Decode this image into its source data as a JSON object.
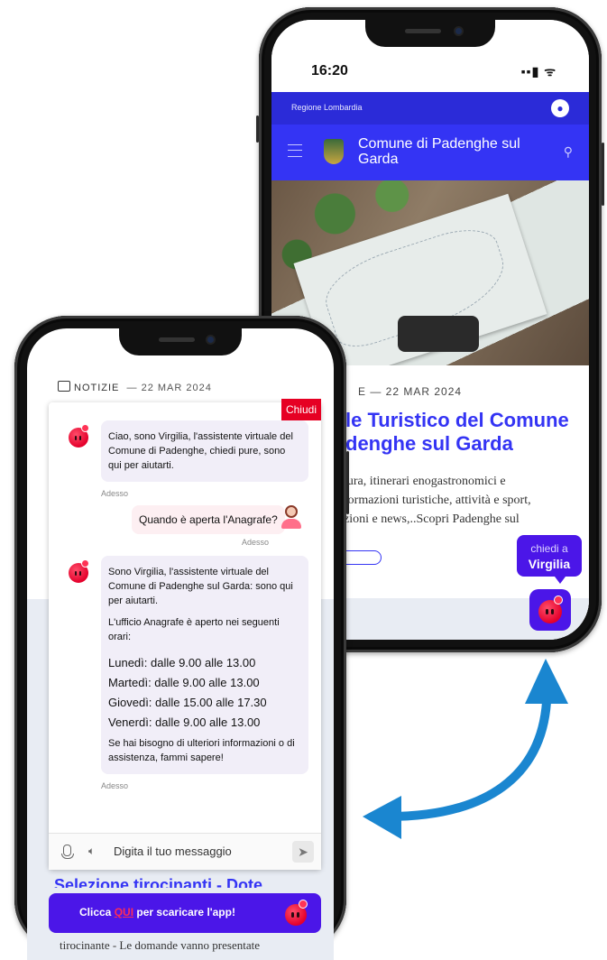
{
  "back_phone": {
    "status_time": "16:20",
    "status_icons": "▪▪▮ ᯤ",
    "region_label": "Regione Lombardia",
    "site_title": "Comune di Padenghe sul Garda",
    "news_date": "E  —  22 MAR 2024",
    "headline": "le Turistico del Comune\ndenghe sul Garda",
    "description": "tura, itinerari enogastronomici e\nformazioni turistiche, attività e sport,\nzioni e news,..Scopri Padenghe sul",
    "virgilia_small": "chiedi a",
    "virgilia_big": "Virgilia"
  },
  "front_phone": {
    "section_label": "NOTIZIE",
    "section_date": "— 22 MAR 2024",
    "close_label": "Chiudi",
    "messages": [
      {
        "from": "bot",
        "text": "Ciao, sono Virgilia, l'assistente virtuale del Comune di Padenghe, chiedi pure, sono qui per aiutarti.",
        "time": "Adesso"
      },
      {
        "from": "user",
        "text": "Quando è aperta l'Anagrafe?",
        "time": "Adesso"
      },
      {
        "from": "bot",
        "intro": "Sono Virgilia, l'assistente virtuale del Comune di Padenghe sul Garda: sono qui per aiutarti.",
        "line2": "L'ufficio Anagrafe è aperto nei seguenti orari:",
        "schedule": [
          "Lunedì: dalle 9.00 alle 13.00",
          "Martedì: dalle 9.00 alle 13.00",
          "Giovedì: dalle 15.00 alle 17.30",
          "Venerdì: dalle 9.00 alle 13.00"
        ],
        "outro": "Se hai bisogno di ulteriori informazioni o di assistenza, fammi sapere!",
        "time": "Adesso"
      }
    ],
    "input_placeholder": "Digita il tuo messaggio",
    "behind_title": "Selezione tirocinanti - Dote",
    "download_prefix": "Clicca ",
    "download_link": "QUI",
    "download_suffix": " per scaricare l'app!",
    "behind_text": "tirocinante - Le domande vanno presentate"
  },
  "colors": {
    "brand_blue": "#3434f4",
    "virgilia_purple": "#4b16e8",
    "close_red": "#e60023",
    "arrow_blue": "#1a86d0"
  }
}
